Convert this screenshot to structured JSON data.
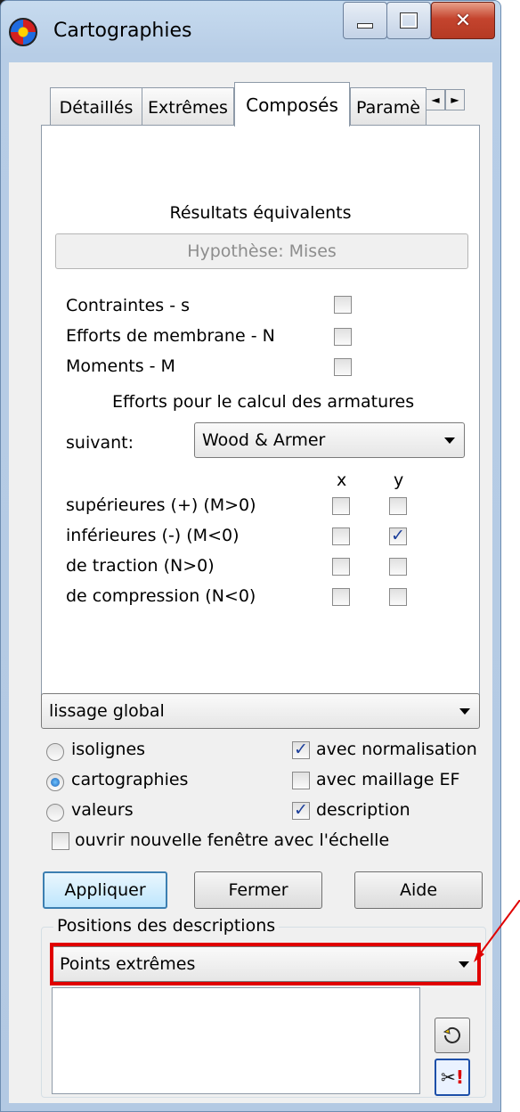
{
  "window": {
    "title": "Cartographies",
    "icon": "cartographies-app-icon"
  },
  "caption_buttons": [
    {
      "name": "minimize-button",
      "icon": "minimize-icon"
    },
    {
      "name": "maximize-button",
      "icon": "maximize-icon"
    },
    {
      "name": "close-button",
      "icon": "close-icon"
    }
  ],
  "tabs": [
    {
      "label": "Détaillés",
      "active": false
    },
    {
      "label": "Extrêmes",
      "active": false
    },
    {
      "label": "Composés",
      "active": true
    },
    {
      "label": "Paramè",
      "active": false
    }
  ],
  "tab_scroll": {
    "left": "◄",
    "right": "►"
  },
  "panel": {
    "section_title": "Résultats équivalents",
    "hypothesis_button": "Hypothèse: Mises",
    "rows": [
      {
        "label": "Contraintes - s",
        "checked": false
      },
      {
        "label": "Efforts de membrane - N",
        "checked": false
      },
      {
        "label": "Moments - M",
        "checked": false
      }
    ],
    "reinforcement_title": "Efforts pour le calcul des armatures",
    "suivant_label": "suivant:",
    "suivant_value": "Wood & Armer",
    "col_x": "x",
    "col_y": "y",
    "reinf_rows": [
      {
        "label": "supérieures (+) (M>0)",
        "x": false,
        "y": false
      },
      {
        "label": "inférieures (-) (M<0)",
        "x": false,
        "y": true
      },
      {
        "label": "de traction (N>0)",
        "x": false,
        "y": false
      },
      {
        "label": "de compression (N<0)",
        "x": false,
        "y": false
      }
    ]
  },
  "smoothing": {
    "value": "lissage global"
  },
  "display_modes": [
    {
      "label": "isolignes",
      "selected": false
    },
    {
      "label": "cartographies",
      "selected": true
    },
    {
      "label": "valeurs",
      "selected": false
    }
  ],
  "options": [
    {
      "label": "avec normalisation",
      "checked": true
    },
    {
      "label": "avec maillage EF",
      "checked": false
    },
    {
      "label": "description",
      "checked": true
    }
  ],
  "new_window_option": {
    "label": "ouvrir nouvelle fenêtre avec l'échelle",
    "checked": false
  },
  "buttons": {
    "apply": "Appliquer",
    "close": "Fermer",
    "help": "Aide"
  },
  "descriptions": {
    "group_title": "Positions des descriptions",
    "value": "Points extrêmes",
    "refresh_icon": "refresh-icon",
    "tool_icon": "cut-settings-icon"
  },
  "annotation": {
    "highlight_color": "#e00000"
  }
}
